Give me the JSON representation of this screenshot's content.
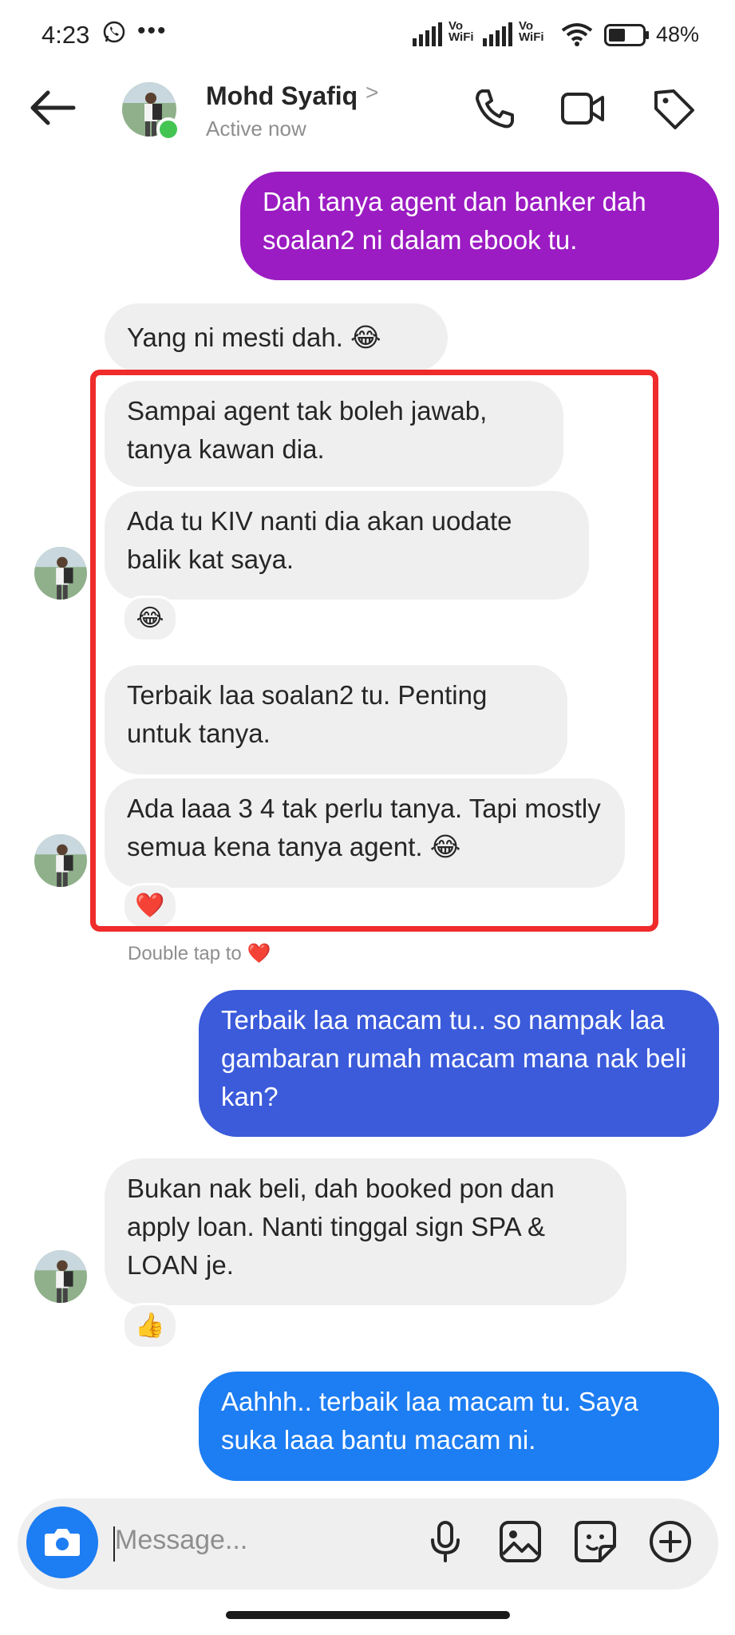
{
  "status_bar": {
    "time": "4:23",
    "volte1": "Vo\nWiFi",
    "volte2": "Vo\nWiFi",
    "battery": "48%"
  },
  "header": {
    "name": "Mohd Syafiq",
    "chevron": ">",
    "status": "Active now"
  },
  "messages": [
    {
      "side": "out",
      "text": "Dah tanya agent dan banker dah soalan2 ni dalam ebook tu."
    },
    {
      "side": "in",
      "text": "Yang ni mesti dah.  😂"
    },
    {
      "side": "in",
      "text": "Sampai agent tak boleh jawab, tanya kawan dia."
    },
    {
      "side": "in",
      "text": "Ada tu KIV nanti dia akan uodate balik kat saya.",
      "reaction": "😂"
    },
    {
      "side": "in",
      "text": "Terbaik laa soalan2 tu. Penting untuk tanya."
    },
    {
      "side": "in",
      "text": "Ada laaa 3 4 tak perlu tanya. Tapi mostly semua kena tanya agent. 😂",
      "reaction": "❤️"
    },
    {
      "side": "out",
      "text": "Terbaik laa macam tu.. so nampak laa gambaran rumah macam mana nak beli kan?"
    },
    {
      "side": "in",
      "text": "Bukan nak beli, dah booked pon dan apply loan. Nanti tinggal sign SPA & LOAN je.",
      "reaction": "👍"
    },
    {
      "side": "out",
      "text": "Aahhh.. terbaik laa macam tu. Saya suka laaa bantu macam ni."
    }
  ],
  "hint": "Double tap to ❤️",
  "composer": {
    "placeholder": "Message..."
  },
  "colors": {
    "out_purple": "#9b1cc2",
    "out_blue_1": "#3b5bdb",
    "out_blue_2": "#1d7df2",
    "in_gray": "#efefef",
    "highlight": "#ef2b2b",
    "online": "#44c552"
  },
  "icons": [
    "whatsapp-icon",
    "more-dots-icon",
    "signal-icon",
    "wifi-icon",
    "battery-icon",
    "back-arrow-icon",
    "phone-icon",
    "video-icon",
    "tag-icon",
    "camera-icon",
    "microphone-icon",
    "gallery-icon",
    "sticker-icon",
    "plus-circle-icon"
  ]
}
